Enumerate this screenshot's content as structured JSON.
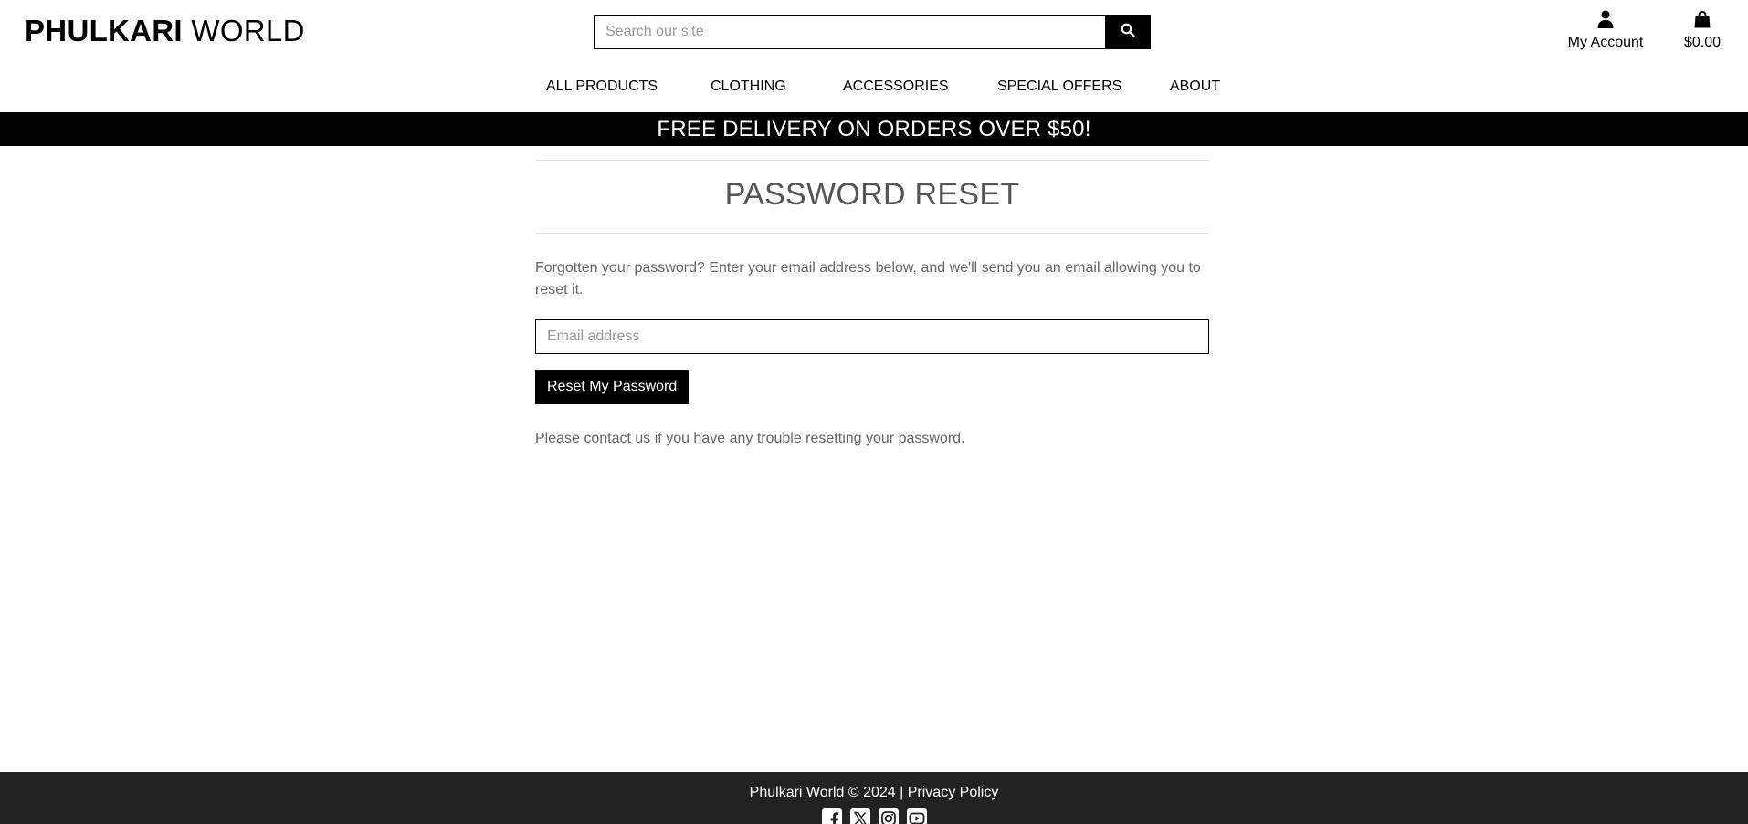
{
  "header": {
    "logo_bold": "PHULKARI",
    "logo_light": "WORLD",
    "search": {
      "placeholder": "Search our site",
      "value": ""
    },
    "account_label": "My Account",
    "bag_total": "$0.00",
    "icons": {
      "search": "search-icon",
      "account": "user-icon",
      "bag": "shopping-bag-icon"
    }
  },
  "nav": {
    "items": [
      {
        "label": "ALL PRODUCTS"
      },
      {
        "label": "CLOTHING"
      },
      {
        "label": "ACCESSORIES"
      },
      {
        "label": "SPECIAL OFFERS"
      },
      {
        "label": "ABOUT"
      }
    ]
  },
  "banner": {
    "text": "FREE DELIVERY ON ORDERS OVER $50!"
  },
  "main": {
    "title": "PASSWORD RESET",
    "intro": "Forgotten your password? Enter your email address below, and we'll send you an email allowing you to reset it.",
    "email_placeholder": "Email address",
    "email_value": "",
    "button_label": "Reset My Password",
    "help": "Please contact us if you have any trouble resetting your password."
  },
  "footer": {
    "copyright": "Phulkari World © 2024 |",
    "privacy_link": "Privacy Policy",
    "socials": [
      "facebook-icon",
      "x-twitter-icon",
      "instagram-icon",
      "youtube-icon"
    ]
  },
  "colors": {
    "black": "#000000",
    "footer_bg": "#222222",
    "muted_text": "#666666",
    "title_text": "#555555",
    "divider": "#e2e2e2"
  }
}
